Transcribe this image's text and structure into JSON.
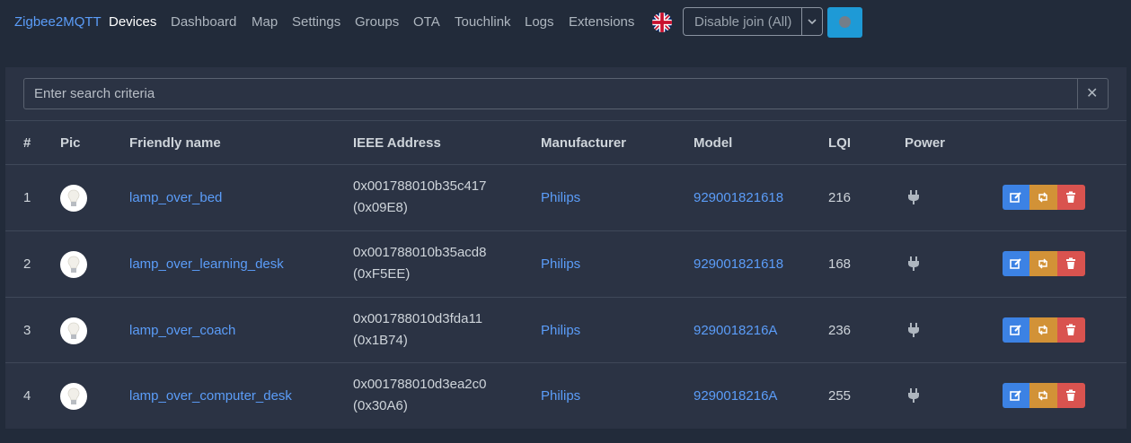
{
  "nav": {
    "brand": "Zigbee2MQTT",
    "links": [
      "Devices",
      "Dashboard",
      "Map",
      "Settings",
      "Groups",
      "OTA",
      "Touchlink",
      "Logs",
      "Extensions"
    ],
    "join_select": "Disable join (All)",
    "language_icon": "uk-flag-icon"
  },
  "search": {
    "placeholder": "Enter search criteria"
  },
  "table": {
    "headers": [
      "#",
      "Pic",
      "Friendly name",
      "IEEE Address",
      "Manufacturer",
      "Model",
      "LQI",
      "Power"
    ],
    "rows": [
      {
        "num": "1",
        "name": "lamp_over_bed",
        "ieee": "0x001788010b35c417",
        "nwk": "(0x09E8)",
        "manufacturer": "Philips",
        "model": "929001821618",
        "lqi": "216"
      },
      {
        "num": "2",
        "name": "lamp_over_learning_desk",
        "ieee": "0x001788010b35acd8",
        "nwk": "(0xF5EE)",
        "manufacturer": "Philips",
        "model": "929001821618",
        "lqi": "168"
      },
      {
        "num": "3",
        "name": "lamp_over_coach",
        "ieee": "0x001788010d3fda11",
        "nwk": "(0x1B74)",
        "manufacturer": "Philips",
        "model": "9290018216A",
        "lqi": "236"
      },
      {
        "num": "4",
        "name": "lamp_over_computer_desk",
        "ieee": "0x001788010d3ea2c0",
        "nwk": "(0x30A6)",
        "manufacturer": "Philips",
        "model": "9290018216A",
        "lqi": "255"
      }
    ]
  },
  "colors": {
    "accent": "#5b9df9",
    "edit": "#3c82e4",
    "rename": "#d29237",
    "delete": "#d9534f",
    "permit_join": "#1e9ad6"
  }
}
